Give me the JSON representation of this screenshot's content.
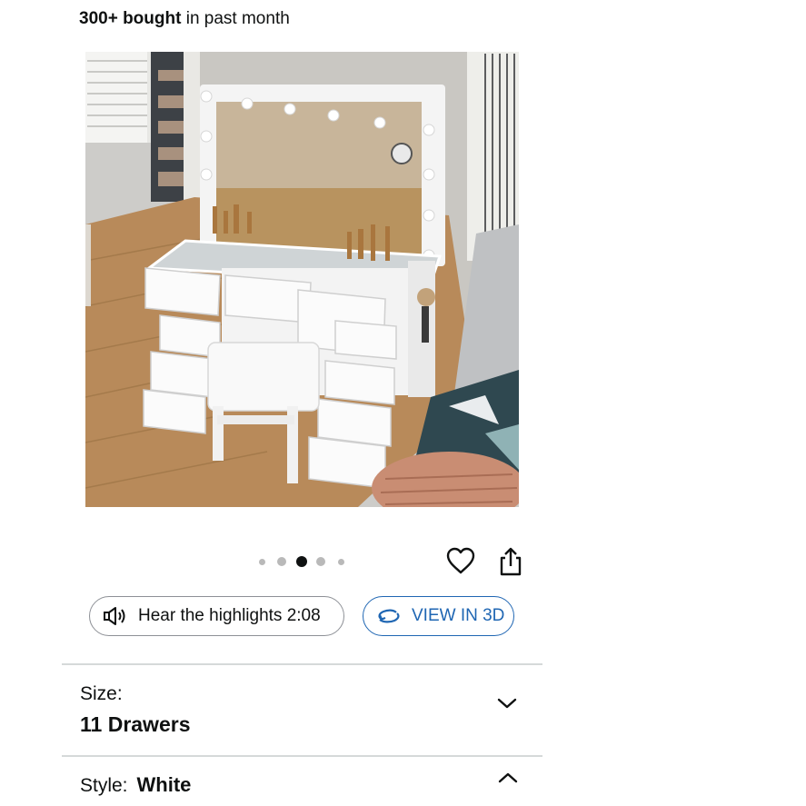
{
  "purchase_info": {
    "bought_count": "300+ bought",
    "bought_suffix": "in past month"
  },
  "product_image": {
    "subject": "white vanity desk with lighted mirror, drawers and stool"
  },
  "carousel": {
    "total_dots": 5,
    "active_index": 2
  },
  "actions": {
    "favorite_icon": "heart-icon",
    "share_icon": "share-icon"
  },
  "audio": {
    "icon": "speaker-icon",
    "label": "Hear the highlights 2:08"
  },
  "view3d": {
    "icon": "rotate-3d-icon",
    "label": "VIEW IN 3D"
  },
  "size": {
    "label": "Size:",
    "value": "11 Drawers",
    "expanded": false
  },
  "style": {
    "label": "Style:",
    "value": "White",
    "expanded": true
  },
  "colors": {
    "text": "#0f1111",
    "link_blue": "#1f66b3",
    "divider": "#d5d9d9",
    "dot_inactive": "#b9b9b9",
    "dot_active": "#0f1111"
  }
}
